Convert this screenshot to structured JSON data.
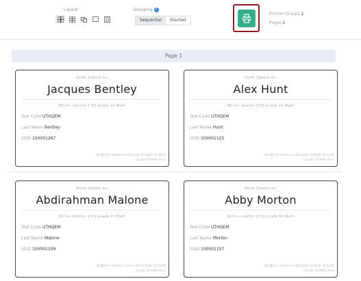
{
  "toolbar": {
    "layout_label": "Layout",
    "grouping_label": "Grouping",
    "grouping_options": [
      "Sequential",
      "Stacked"
    ],
    "grouping_selected": "Sequential",
    "proctor_groups_label": "Proctor Groups",
    "proctor_groups_value": "1",
    "pages_label": "Pages",
    "pages_value": "1",
    "print_icon": "print-icon",
    "accent_color": "#33b08a",
    "highlight_color": "#8e1c25"
  },
  "page_banner": "Page 1",
  "cards": [
    {
      "org": "North Dakota A+",
      "name": "Jacques Bentley",
      "test": "ND A+ Interim 2 HS Grade 10 Math",
      "test_code_label": "Test Code",
      "test_code": "UTHQEM",
      "last_name_label": "Last Name",
      "last_name": "Bentley",
      "ssid_label": "SSID",
      "ssid": "100001267",
      "footer_line1": "SE ND A+ Interim 2 HS Grade 10 Math SY 2425",
      "footer_line2": "Grade 10 Math Accs"
    },
    {
      "org": "North Dakota A+",
      "name": "Alex Hunt",
      "test": "ND A+ Interim 2 HS Grade 10 Math",
      "test_code_label": "Test Code",
      "test_code": "UTHQEM",
      "last_name_label": "Last Name",
      "last_name": "Hunt",
      "ssid_label": "SSID",
      "ssid": "100001125",
      "footer_line1": "SE ND A+ Interim 2 HS Grade 10 Math SY 2425",
      "footer_line2": "Grade 10 Math Accs"
    },
    {
      "org": "North Dakota A+",
      "name": "Abdirahman Malone",
      "test": "ND A+ Interim 2 HS Grade 10 Math",
      "test_code_label": "Test Code",
      "test_code": "UTHQEM",
      "last_name_label": "Last Name",
      "last_name": "Malone",
      "ssid_label": "SSID",
      "ssid": "100001109",
      "footer_line1": "SE ND A+ Interim 2 HS Grade 10 Math SY 2425",
      "footer_line2": "Grade 10 Math Accs"
    },
    {
      "org": "North Dakota A+",
      "name": "Abby Morton",
      "test": "ND A+ Interim 2 HS Grade 10 Math",
      "test_code_label": "Test Code",
      "test_code": "UTHQEM",
      "last_name_label": "Last Name",
      "last_name": "Morton",
      "ssid_label": "SSID",
      "ssid": "100001107",
      "footer_line1": "SE ND A+ Interim 2 HS Grade 10 Math SY 2425",
      "footer_line2": "Grade 10 Math Accs"
    }
  ]
}
